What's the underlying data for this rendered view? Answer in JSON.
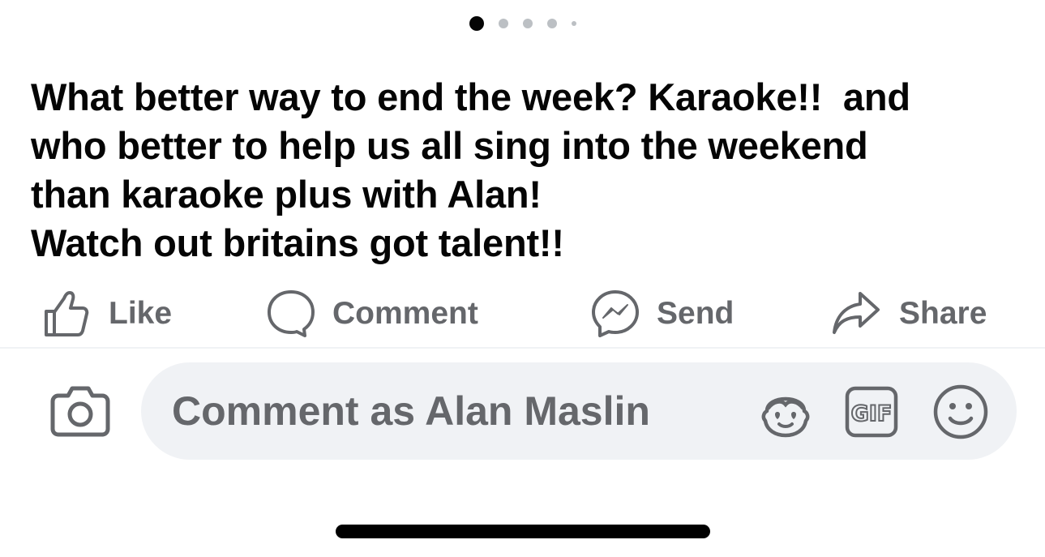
{
  "carousel": {
    "dot_count": 5,
    "active_index": 0
  },
  "post": {
    "lines": [
      "What better way to end the week? Karaoke!!  and",
      "who better to help us all sing into the weekend",
      "than karaoke plus with Alan!",
      "Watch out britains got talent!!"
    ]
  },
  "actions": {
    "like_label": "Like",
    "comment_label": "Comment",
    "send_label": "Send",
    "share_label": "Share"
  },
  "composer": {
    "placeholder": "Comment as Alan Maslin",
    "gif_label": "GIF"
  },
  "icons": {
    "like": "thumbs-up-icon",
    "comment": "speech-bubble-icon",
    "send": "messenger-icon",
    "share": "share-arrow-icon",
    "camera": "camera-icon",
    "avatar": "avatar-sticker-icon",
    "gif": "gif-icon",
    "emoji": "smiley-icon"
  },
  "colors": {
    "text": "#050505",
    "muted": "#65676b",
    "composer_bg": "#f0f2f5",
    "dot_inactive": "#bcc0c4",
    "dot_active": "#050505"
  }
}
